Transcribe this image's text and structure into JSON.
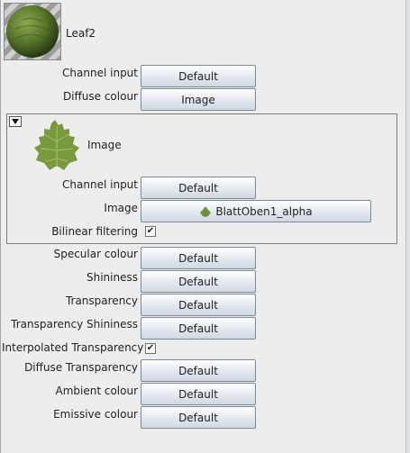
{
  "material": {
    "name": "Leaf2",
    "thumbnail_icon": "leaf-ball-texture"
  },
  "top_fields": [
    {
      "label": "Channel input",
      "value": "Default"
    },
    {
      "label": "Diffuse colour",
      "value": "Image"
    }
  ],
  "image_panel": {
    "title": "Image",
    "collapse_icon": "triangle-down-icon",
    "channel_input": {
      "label": "Channel input",
      "value": "Default"
    },
    "image": {
      "label": "Image",
      "value": "BlattOben1_alpha"
    },
    "bilinear_filtering": {
      "label": "Bilinear filtering",
      "checked": true,
      "mark": "✔"
    }
  },
  "bottom_fields": [
    {
      "label": "Specular colour",
      "value": "Default"
    },
    {
      "label": "Shininess",
      "value": "Default"
    },
    {
      "label": "Transparency",
      "value": "Default"
    },
    {
      "label": "Transparency Shininess",
      "value": "Default"
    }
  ],
  "interpolated_transparency": {
    "label": "Interpolated Transparency",
    "checked": true,
    "mark": "✔"
  },
  "bottom_fields_2": [
    {
      "label": "Diffuse Transparency",
      "value": "Default"
    },
    {
      "label": "Ambient colour",
      "value": "Default"
    },
    {
      "label": "Emissive colour",
      "value": "Default"
    }
  ],
  "colors": {
    "leaf_green": "#6f8f3a",
    "sphere_green": "#4d6a26",
    "panel_border": "#7d7d7d"
  }
}
